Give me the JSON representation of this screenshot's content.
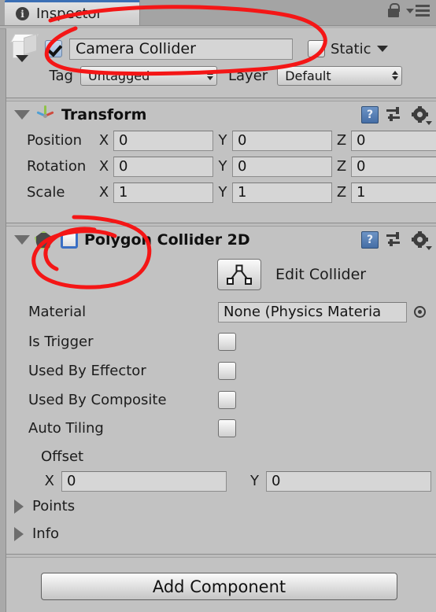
{
  "window": {
    "tab_label": "Inspector",
    "tab_icon": "info-circle-icon",
    "lock_icon": "padlock-icon",
    "menu_icon": "hamburger-menu-icon"
  },
  "gameobject": {
    "icon": "cube-icon",
    "enabled": true,
    "name": "Camera Collider",
    "static_label": "Static",
    "static_checked": false,
    "tag_label": "Tag",
    "tag_value": "Untagged",
    "layer_label": "Layer",
    "layer_value": "Default"
  },
  "transform": {
    "title": "Transform",
    "icon": "transform-axis-gizmo-icon",
    "expanded": true,
    "rows": [
      {
        "label": "Position",
        "x": "0",
        "y": "0",
        "z": "0"
      },
      {
        "label": "Rotation",
        "x": "0",
        "y": "0",
        "z": "0"
      },
      {
        "label": "Scale",
        "x": "1",
        "y": "1",
        "z": "1"
      }
    ],
    "axis_x": "X",
    "axis_y": "Y",
    "axis_z": "Z"
  },
  "polygon_collider": {
    "title": "Polygon Collider 2D",
    "icon": "polygon-collider-icon",
    "expanded": true,
    "enabled": false,
    "edit_collider_label": "Edit Collider",
    "edit_collider_icon": "polygon-edit-icon",
    "material_label": "Material",
    "material_value": "None (Physics Materia",
    "material_picker_icon": "object-picker-icon",
    "toggles": [
      {
        "label": "Is Trigger",
        "checked": false
      },
      {
        "label": "Used By Effector",
        "checked": false
      },
      {
        "label": "Used By Composite",
        "checked": false
      },
      {
        "label": "Auto Tiling",
        "checked": false
      }
    ],
    "offset_label": "Offset",
    "offset_x_axis": "X",
    "offset_x": "0",
    "offset_y_axis": "Y",
    "offset_y": "0",
    "foldouts": [
      {
        "label": "Points"
      },
      {
        "label": "Info"
      }
    ]
  },
  "footer": {
    "add_component_label": "Add Component"
  },
  "component_header_icons": {
    "help": "help-book-icon",
    "preset": "preset-sliders-icon",
    "settings": "gear-icon"
  },
  "annotations": {
    "color": "#f41616",
    "marks": [
      {
        "name": "name-field-circle"
      },
      {
        "name": "collider-checkbox-circle"
      }
    ]
  }
}
